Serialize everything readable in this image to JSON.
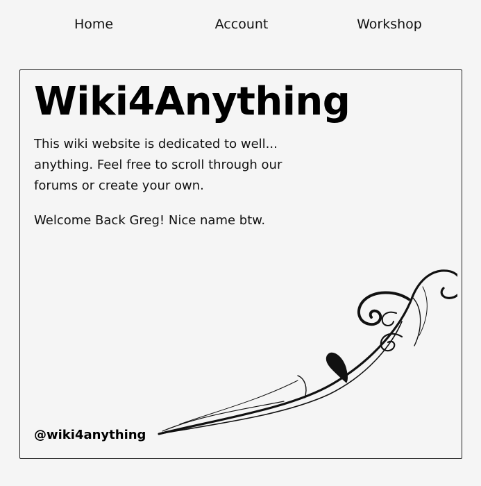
{
  "nav": {
    "items": [
      {
        "label": "Home"
      },
      {
        "label": "Account"
      },
      {
        "label": "Workshop"
      }
    ]
  },
  "main": {
    "title": "Wiki4Anything",
    "description": "This wiki website is dedicated to well... anything. Feel free to scroll through our forums or create your own.",
    "welcome": "Welcome Back Greg! Nice name btw.",
    "handle": "@wiki4anything",
    "decoration_icon": "flourish-ornament"
  }
}
